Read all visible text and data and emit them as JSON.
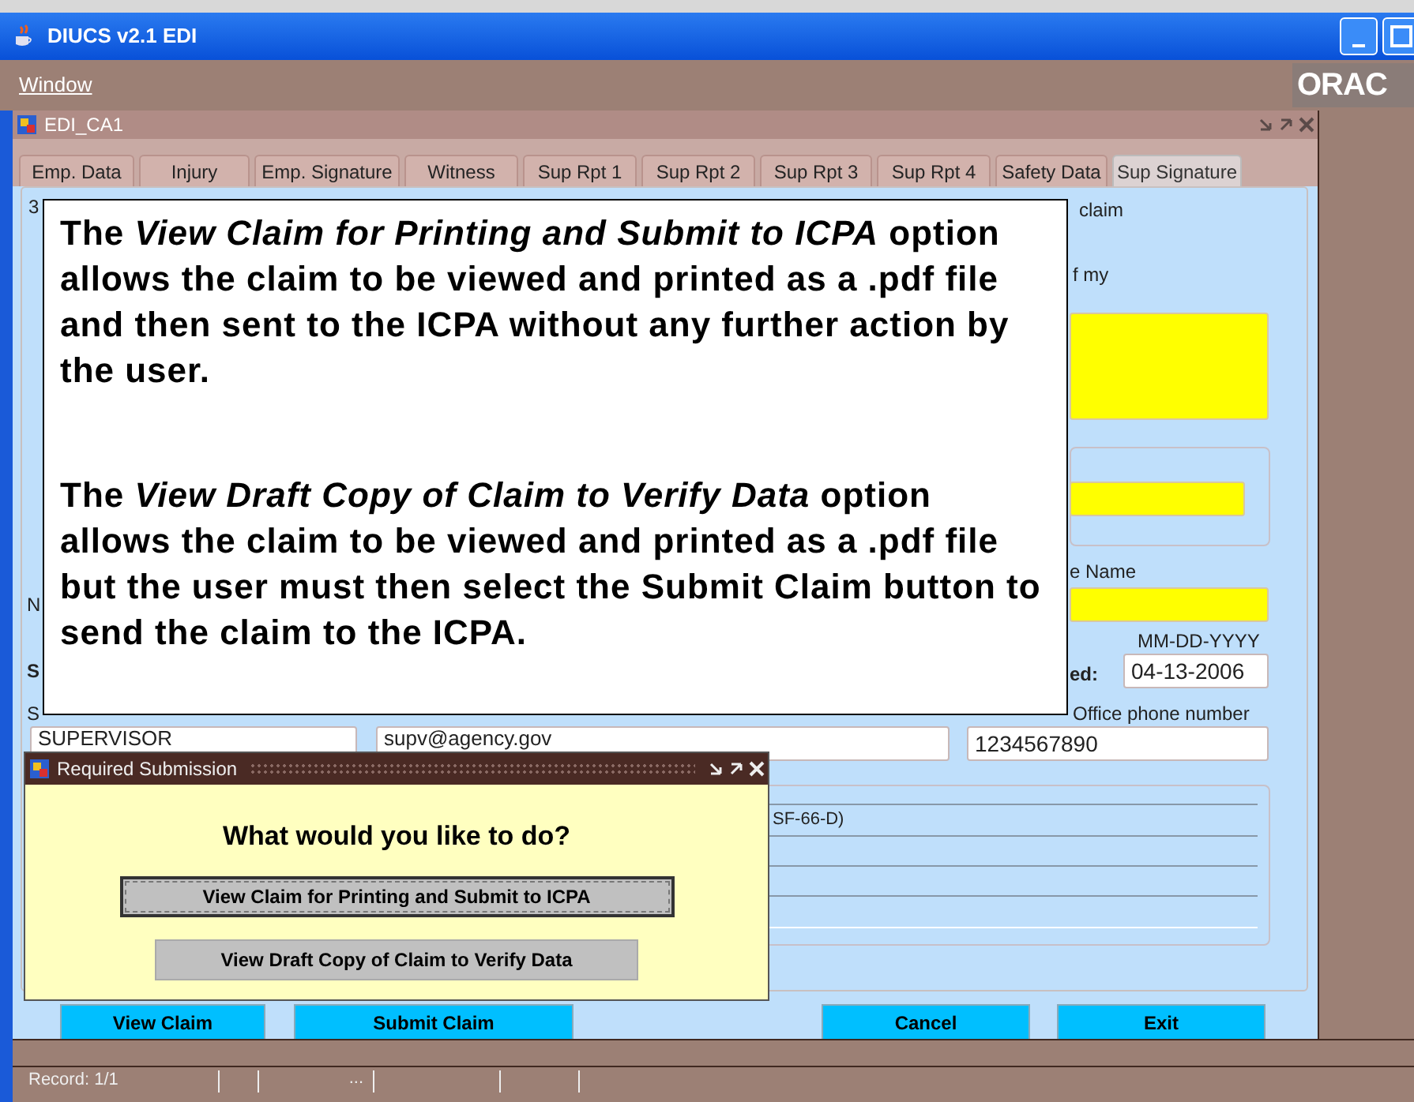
{
  "app": {
    "title": "DIUCS v2.1 EDI",
    "menu": [
      "Window"
    ],
    "logo": "ORAC"
  },
  "form_window": {
    "title": "EDI_CA1"
  },
  "tabs": [
    {
      "label": "Emp. Data",
      "selected": false
    },
    {
      "label": "Injury",
      "selected": false
    },
    {
      "label": "Emp. Signature",
      "selected": false
    },
    {
      "label": "Witness",
      "selected": false
    },
    {
      "label": "Sup Rpt 1",
      "selected": false
    },
    {
      "label": "Sup Rpt 2",
      "selected": false
    },
    {
      "label": "Sup Rpt 3",
      "selected": false
    },
    {
      "label": "Sup Rpt 4",
      "selected": false
    },
    {
      "label": "Safety Data",
      "selected": false
    },
    {
      "label": "Sup Signature",
      "selected": true
    }
  ],
  "form": {
    "number_fragment": "3",
    "cert_fragment_1": "claim",
    "cert_fragment_2": "f my",
    "name_label_fragment": "N",
    "name_label": "e Name",
    "date_hint": "MM-DD-YYYY",
    "date_label_fragment": "S",
    "date_label": "ed:",
    "date_value": "04-13-2006",
    "phone_label_fragment": "S",
    "phone_label": "Office phone number",
    "title_value": "SUPERVISOR",
    "email_value": "supv@agency.gov",
    "phone_value": "1234567890",
    "form_list_item": "SF-66-D)"
  },
  "buttons": [
    "View Claim",
    "Submit Claim",
    "Cancel",
    "Exit"
  ],
  "callout": {
    "paragraphs": [
      "The *View Claim for Printing and Submit to ICPA* option allows the claim to be viewed and printed as a .pdf file and then sent to the ICPA without any further action by the user.",
      "The *View Draft Copy of Claim to Verify Data* option allows the claim to be viewed and printed as a .pdf file but the user must then select the **Submit Claim** button to send the claim to the ICPA."
    ]
  },
  "dialog": {
    "title": "Required Submission",
    "question": "What would you like to do?",
    "options": [
      {
        "label": "View Claim for Printing and Submit to ICPA",
        "focused": true
      },
      {
        "label": "View Draft Copy of Claim to Verify Data",
        "focused": false
      }
    ]
  },
  "status": {
    "record": "Record: 1/1",
    "ellipsis": "..."
  }
}
